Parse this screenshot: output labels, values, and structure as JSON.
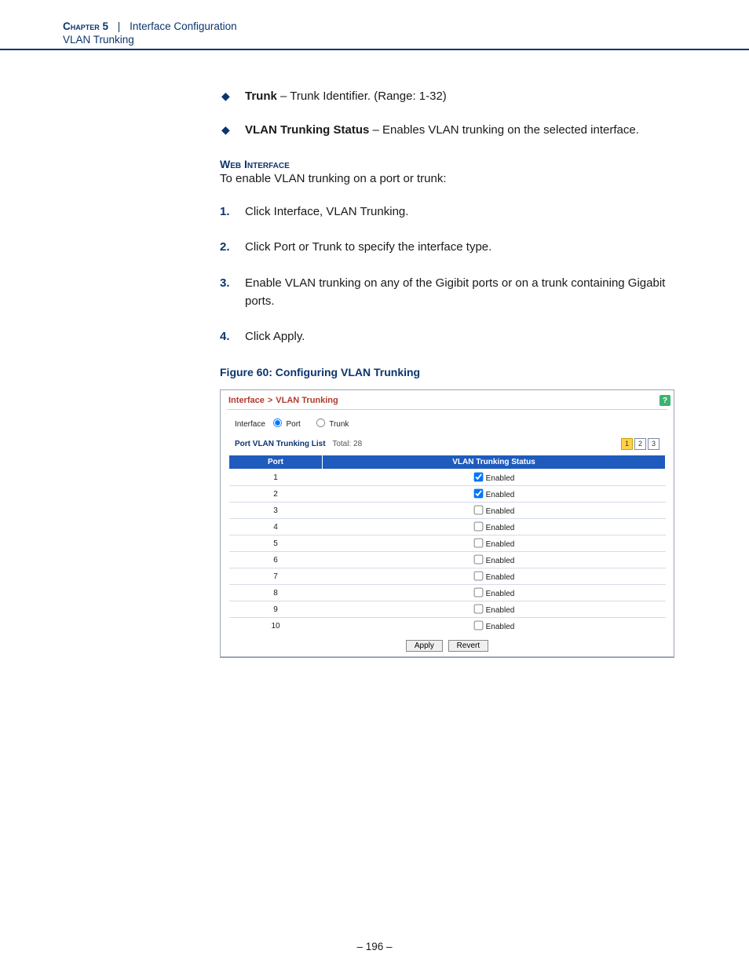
{
  "header": {
    "chapter": "Chapter 5",
    "sep": "|",
    "title": "Interface Configuration",
    "subtitle": "VLAN Trunking"
  },
  "bullets": [
    {
      "term": "Trunk",
      "desc": " – Trunk Identifier. (Range: 1-32)"
    },
    {
      "term": "VLAN Trunking Status",
      "desc": " – Enables VLAN trunking on the selected interface."
    }
  ],
  "web_interface_title": "Web Interface",
  "lead": "To enable VLAN trunking on a port or trunk:",
  "steps": [
    "Click Interface, VLAN Trunking.",
    "Click Port or Trunk to specify the interface type.",
    "Enable VLAN trunking on any of the Gigibit ports or on a trunk containing Gigabit ports.",
    "Click Apply."
  ],
  "figure_title": "Figure 60:  Configuring VLAN Trunking",
  "ui": {
    "breadcrumb": [
      "Interface",
      "VLAN Trunking"
    ],
    "help_icon": "?",
    "iface_label": "Interface",
    "radio_port": "Port",
    "radio_trunk": "Trunk",
    "list_label": "Port VLAN Trunking List",
    "total_label": "Total:",
    "total_value": "28",
    "pager": [
      "1",
      "2",
      "3"
    ],
    "pager_active": "1",
    "columns": [
      "Port",
      "VLAN Trunking Status"
    ],
    "status_label": "Enabled",
    "rows": [
      {
        "port": "1",
        "checked": true
      },
      {
        "port": "2",
        "checked": true
      },
      {
        "port": "3",
        "checked": false
      },
      {
        "port": "4",
        "checked": false
      },
      {
        "port": "5",
        "checked": false
      },
      {
        "port": "6",
        "checked": false
      },
      {
        "port": "7",
        "checked": false
      },
      {
        "port": "8",
        "checked": false
      },
      {
        "port": "9",
        "checked": false
      },
      {
        "port": "10",
        "checked": false
      }
    ],
    "buttons": {
      "apply": "Apply",
      "revert": "Revert"
    }
  },
  "page_number": "–  196  –"
}
